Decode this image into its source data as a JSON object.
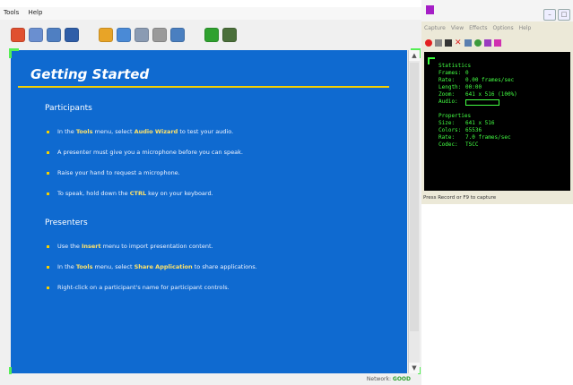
{
  "app": {
    "menu": [
      "Tools",
      "Help"
    ],
    "toolbar_icons": [
      {
        "name": "record-icon",
        "color": "#e05030"
      },
      {
        "name": "presentation-icon",
        "color": "#6a8fd0"
      },
      {
        "name": "document-icon",
        "color": "#4f7fc2"
      },
      {
        "name": "book-icon",
        "color": "#2f5ea8"
      },
      {
        "name": "share-icon",
        "color": "#e8a427",
        "gap": true
      },
      {
        "name": "chat-icon",
        "color": "#4a8ad6"
      },
      {
        "name": "people-icon",
        "color": "#8a9bb3"
      },
      {
        "name": "globe-icon",
        "color": "#9a9a9a"
      },
      {
        "name": "edit-icon",
        "color": "#4a7fc0"
      },
      {
        "name": "pointer-icon",
        "color": "#2fa12f",
        "gap": true
      },
      {
        "name": "meter-icon",
        "color": "#4a6f3a"
      }
    ],
    "colors": {
      "slide_bg": "#0f6ad0",
      "accent": "#f5d000"
    },
    "slide": {
      "title": "Getting Started",
      "participants_heading": "Participants",
      "participants": [
        {
          "pre": "In the ",
          "em": "Tools",
          "mid": " menu, select ",
          "em2": "Audio Wizard",
          "post": " to test your audio."
        },
        {
          "pre": "A presenter must give you a microphone before you can speak.",
          "em": "",
          "mid": "",
          "em2": "",
          "post": ""
        },
        {
          "pre": "Raise your hand to request a microphone.",
          "em": "",
          "mid": "",
          "em2": "",
          "post": ""
        },
        {
          "pre": "To speak, hold down the ",
          "em": "CTRL",
          "mid": " key on your keyboard.",
          "em2": "",
          "post": ""
        }
      ],
      "presenters_heading": "Presenters",
      "presenters": [
        {
          "pre": "Use the ",
          "em": "Insert",
          "mid": " menu to import presentation content.",
          "em2": "",
          "post": ""
        },
        {
          "pre": "In the ",
          "em": "Tools",
          "mid": " menu, select ",
          "em2": "Share Application",
          "post": " to share applications."
        },
        {
          "pre": "Right-click on a participant's name for participant controls.",
          "em": "",
          "mid": "",
          "em2": "",
          "post": ""
        }
      ]
    },
    "status": {
      "label": "Network:",
      "value": "GOOD"
    }
  },
  "capture": {
    "menu": [
      "Capture",
      "View",
      "Effects",
      "Options",
      "Help"
    ],
    "stats": [
      {
        "k": "Statistics",
        "v": ""
      },
      {
        "k": "Frames:",
        "v": "0"
      },
      {
        "k": "Rate:",
        "v": "0.00 frames/sec"
      },
      {
        "k": "Length:",
        "v": "00:00"
      },
      {
        "k": "Zoom:",
        "v": "641 x 516 (100%)"
      },
      {
        "k": "Audio:",
        "v": ""
      },
      {
        "k": "",
        "v": ""
      },
      {
        "k": "Properties",
        "v": ""
      },
      {
        "k": "Size:",
        "v": "641 x 516"
      },
      {
        "k": "Colors:",
        "v": "65536"
      },
      {
        "k": "Rate:",
        "v": "7.0 frames/sec"
      },
      {
        "k": "Codec:",
        "v": "TSCC"
      }
    ],
    "status_text": "Press Record or F9 to capture"
  }
}
